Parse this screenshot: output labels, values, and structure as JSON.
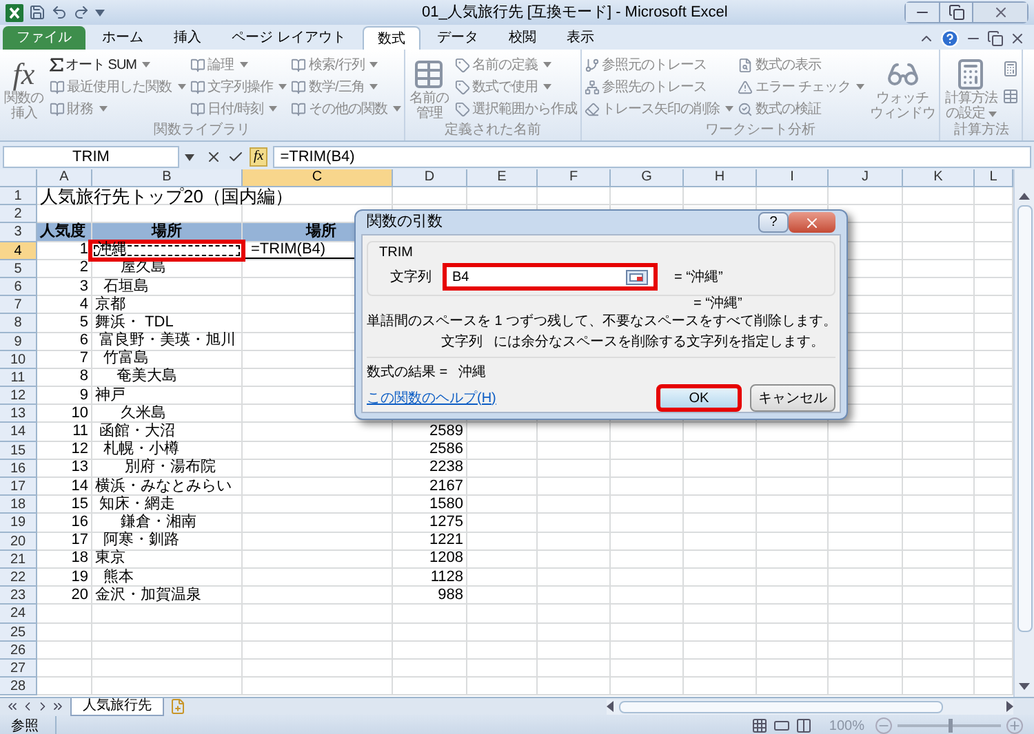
{
  "window": {
    "title": "01_人気旅行先 [互換モード] - Microsoft Excel"
  },
  "ribbon_tabs": [
    {
      "label": "ファイル",
      "kind": "file",
      "selected": false
    },
    {
      "label": "ホーム",
      "kind": "tab",
      "selected": false
    },
    {
      "label": "挿入",
      "kind": "tab",
      "selected": false
    },
    {
      "label": "ページ レイアウト",
      "kind": "tab",
      "selected": false
    },
    {
      "label": "数式",
      "kind": "tab",
      "selected": true
    },
    {
      "label": "データ",
      "kind": "tab",
      "selected": false
    },
    {
      "label": "校閲",
      "kind": "tab",
      "selected": false
    },
    {
      "label": "表示",
      "kind": "tab",
      "selected": false
    }
  ],
  "ribbon": {
    "disabled": true,
    "groups": [
      {
        "label": "関数ライブラリ",
        "large": {
          "glyph": "fx",
          "lines": [
            "関数の",
            "挿入"
          ],
          "dropdown": false
        },
        "columns": [
          [
            {
              "label": "オート SUM",
              "dropdown": true
            },
            {
              "label": "最近使用した関数",
              "dropdown": true
            },
            {
              "label": "財務",
              "dropdown": true
            }
          ],
          [
            {
              "label": "論理",
              "dropdown": true
            },
            {
              "label": "文字列操作",
              "dropdown": true
            },
            {
              "label": "日付/時刻",
              "dropdown": true
            }
          ],
          [
            {
              "label": "検索/行列",
              "dropdown": true
            },
            {
              "label": "数学/三角",
              "dropdown": true
            },
            {
              "label": "その他の関数",
              "dropdown": true
            }
          ]
        ]
      },
      {
        "label": "定義された名前",
        "large": {
          "lines": [
            "名前の",
            "管理"
          ],
          "dropdown": false
        },
        "columns": [
          [
            {
              "label": "名前の定義",
              "dropdown": true
            },
            {
              "label": "数式で使用",
              "dropdown": true
            },
            {
              "label": "選択範囲から作成",
              "dropdown": false
            }
          ]
        ]
      },
      {
        "label": "ワークシート分析",
        "columns": [
          [
            {
              "label": "参照元のトレース",
              "dropdown": false
            },
            {
              "label": "参照先のトレース",
              "dropdown": false
            },
            {
              "label": "トレース矢印の削除",
              "dropdown": true
            }
          ],
          [
            {
              "label": "数式の表示",
              "dropdown": false
            },
            {
              "label": "エラー チェック",
              "dropdown": true
            },
            {
              "label": "数式の検証",
              "dropdown": false
            }
          ]
        ],
        "large_after": {
          "lines": [
            "ウォッチ",
            "ウィンドウ"
          ],
          "dropdown": false
        }
      },
      {
        "label": "計算方法",
        "large": {
          "lines": [
            "計算方法",
            "の設定"
          ],
          "dropdown": true
        }
      }
    ]
  },
  "formula_bar": {
    "name_box": "TRIM",
    "function_glyph": "fx",
    "formula": "=TRIM(B4)"
  },
  "columns": [
    {
      "label": "A",
      "selected": false
    },
    {
      "label": "B",
      "selected": false
    },
    {
      "label": "C",
      "selected": true
    },
    {
      "label": "D",
      "selected": false
    },
    {
      "label": "E",
      "selected": false
    },
    {
      "label": "F",
      "selected": false
    },
    {
      "label": "G",
      "selected": false
    },
    {
      "label": "H",
      "selected": false
    },
    {
      "label": "I",
      "selected": false
    },
    {
      "label": "J",
      "selected": false
    },
    {
      "label": "K",
      "selected": false
    },
    {
      "label": "L",
      "selected": false
    }
  ],
  "rows": [
    {
      "number": "1",
      "selected": false,
      "kind": "title",
      "a": "人気旅行先トップ20（国内編）"
    },
    {
      "number": "2",
      "selected": false,
      "kind": "empty"
    },
    {
      "number": "3",
      "selected": false,
      "kind": "header",
      "a": "人気度",
      "b": "場所",
      "c": "場所"
    },
    {
      "number": "4",
      "selected": true,
      "kind": "data",
      "a": "1",
      "b": "沖縄",
      "b_marquee": true,
      "b_highlighted": true,
      "c": "=TRIM(B4)"
    },
    {
      "number": "5",
      "selected": false,
      "kind": "data",
      "a": "2",
      "b": "      屋久島"
    },
    {
      "number": "6",
      "selected": false,
      "kind": "data",
      "a": "3",
      "b": "  石垣島"
    },
    {
      "number": "7",
      "selected": false,
      "kind": "data",
      "a": "4",
      "b": "京都"
    },
    {
      "number": "8",
      "selected": false,
      "kind": "data",
      "a": "5",
      "b": "舞浜・ TDL"
    },
    {
      "number": "9",
      "selected": false,
      "kind": "data",
      "a": "6",
      "b": " 富良野・美瑛・旭川"
    },
    {
      "number": "10",
      "selected": false,
      "kind": "data",
      "a": "7",
      "b": "  竹富島"
    },
    {
      "number": "11",
      "selected": false,
      "kind": "data",
      "a": "8",
      "b": "     奄美大島"
    },
    {
      "number": "12",
      "selected": false,
      "kind": "data",
      "a": "9",
      "b": "神戸"
    },
    {
      "number": "13",
      "selected": false,
      "kind": "data",
      "a": "10",
      "b": "      久米島"
    },
    {
      "number": "14",
      "selected": false,
      "kind": "data",
      "a": "11",
      "b": " 函館・大沼",
      "d": "2589"
    },
    {
      "number": "15",
      "selected": false,
      "kind": "data",
      "a": "12",
      "b": "  札幌・小樽",
      "d": "2586"
    },
    {
      "number": "16",
      "selected": false,
      "kind": "data",
      "a": "13",
      "b": "       別府・湯布院",
      "d": "2238"
    },
    {
      "number": "17",
      "selected": false,
      "kind": "data",
      "a": "14",
      "b": "横浜・みなとみらい",
      "d": "2167"
    },
    {
      "number": "18",
      "selected": false,
      "kind": "data",
      "a": "15",
      "b": " 知床・網走",
      "d": "1580"
    },
    {
      "number": "19",
      "selected": false,
      "kind": "data",
      "a": "16",
      "b": "      鎌倉・湘南",
      "d": "1275"
    },
    {
      "number": "20",
      "selected": false,
      "kind": "data",
      "a": "17",
      "b": "  阿寒・釧路",
      "d": "1221"
    },
    {
      "number": "21",
      "selected": false,
      "kind": "data",
      "a": "18",
      "b": "東京",
      "d": "1208"
    },
    {
      "number": "22",
      "selected": false,
      "kind": "data",
      "a": "19",
      "b": "  熊本",
      "d": "1128"
    },
    {
      "number": "23",
      "selected": false,
      "kind": "data",
      "a": "20",
      "b": "金沢・加賀温泉",
      "d": "988"
    },
    {
      "number": "24",
      "selected": false,
      "kind": "empty"
    },
    {
      "number": "25",
      "selected": false,
      "kind": "empty"
    },
    {
      "number": "26",
      "selected": false,
      "kind": "empty"
    },
    {
      "number": "27",
      "selected": false,
      "kind": "empty"
    },
    {
      "number": "28",
      "selected": false,
      "kind": "empty"
    }
  ],
  "dialog": {
    "title": "関数の引数",
    "help_button": "?",
    "function_name": "TRIM",
    "argument": {
      "label": "文字列",
      "value": "B4",
      "highlighted": true,
      "preview": "= “沖縄”"
    },
    "result_preview": "= “沖縄”",
    "description": "単語間のスペースを 1 つずつ残して、不要なスペースをすべて削除します。",
    "argument_help": {
      "name": "文字列",
      "text": "には余分なスペースを削除する文字列を指定します。"
    },
    "formula_result_label": "数式の結果 =",
    "formula_result": "沖縄",
    "help_link": "この関数のヘルプ(H)",
    "buttons": [
      {
        "label": "OK",
        "default": true,
        "highlighted": true
      },
      {
        "label": "キャンセル",
        "default": false,
        "highlighted": false
      }
    ]
  },
  "sheet_tabs": [
    {
      "label": "人気旅行先",
      "selected": true
    }
  ],
  "status_bar": {
    "mode": "参照",
    "zoom": "100%",
    "zoom_slider": {
      "level": 0.5
    }
  }
}
